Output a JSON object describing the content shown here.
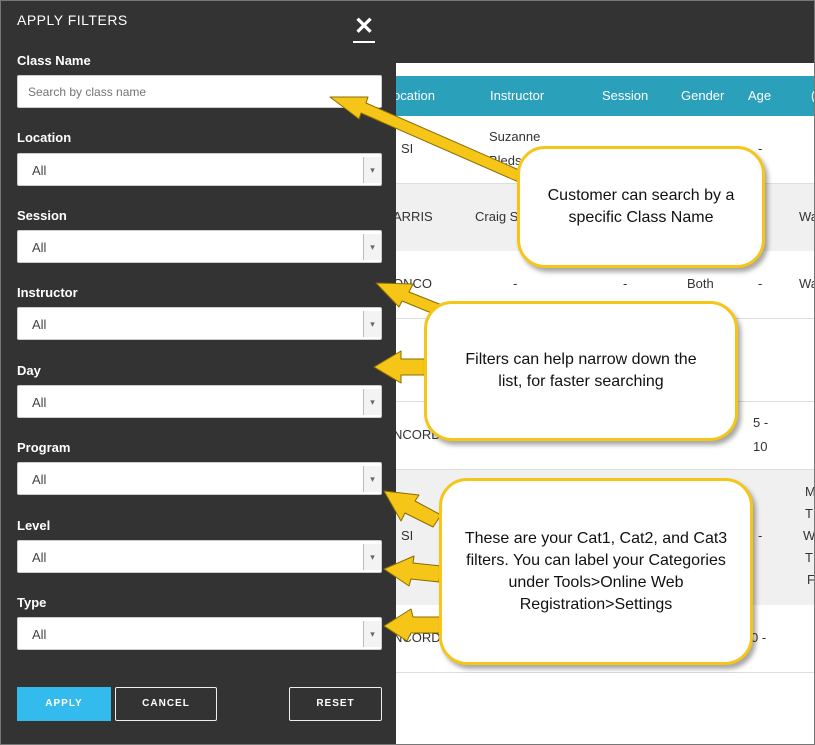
{
  "panel": {
    "title": "APPLY FILTERS",
    "close_glyph": "✕",
    "class_name": {
      "label": "Class Name",
      "placeholder": "Search by class name"
    },
    "filters": [
      {
        "label": "Location",
        "value": "All"
      },
      {
        "label": "Session",
        "value": "All"
      },
      {
        "label": "Instructor",
        "value": "All"
      },
      {
        "label": "Day",
        "value": "All"
      },
      {
        "label": "Program",
        "value": "All"
      },
      {
        "label": "Level",
        "value": "All"
      },
      {
        "label": "Type",
        "value": "All"
      }
    ],
    "buttons": {
      "apply": "APPLY",
      "cancel": "CANCEL",
      "reset": "RESET"
    }
  },
  "table": {
    "headers": [
      "ocation",
      "Instructor",
      "Session",
      "Gender",
      "Age",
      "("
    ],
    "rows": [
      {
        "location": "SI",
        "instructor_1": "Suzanne",
        "instructor_2": "Bledsoe",
        "age": "-"
      },
      {
        "location": "ARRIS",
        "instructor": "Craig S",
        "extra": "Wa"
      },
      {
        "location": "ONCO",
        "instructor": "-",
        "session": "-",
        "gender": "Both",
        "age": "-",
        "extra": "Wa"
      },
      {
        "location": "NCORD",
        "age_1": "5 -",
        "age_2": "10"
      },
      {
        "location": "SI",
        "age": "-",
        "col_1": "M",
        "col_2": "T",
        "col_3": "W",
        "col_4": "T",
        "col_5": "F"
      },
      {
        "location": "NCORD",
        "age": "0 -"
      }
    ]
  },
  "callouts": {
    "search": "Customer can search by a specific Class Name",
    "filters": "Filters can help narrow down the list, for faster searching",
    "categories": "These are your Cat1, Cat2, and Cat3 filters.  You can label your Categories under Tools>Online Web Registration>Settings"
  },
  "colors": {
    "panel_bg": "#333333",
    "header_bg": "#2aa0bb",
    "apply_btn": "#33bbee",
    "callout_border": "#f5c518"
  }
}
